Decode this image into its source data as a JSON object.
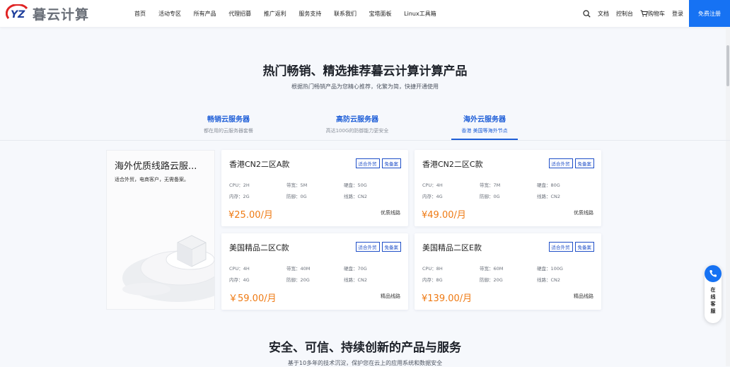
{
  "header": {
    "logo_text": "暮云计算",
    "logo_mark": "YZ",
    "nav": [
      "首页",
      "活动专区",
      "所有产品",
      "代理招募",
      "推广返利",
      "服务支持",
      "联系我们",
      "宝塔面板",
      "Linux工具箱"
    ],
    "docs_label": "文档",
    "console_label": "控制台",
    "cart_label": "购物车",
    "login_label": "登录",
    "register_label": "免费注册"
  },
  "hero": {
    "title": "热门畅销、精选推荐暮云计算计算产品",
    "subtitle": "根据热门畅销产品为您精心推荐，化繁为简，快捷开通使用"
  },
  "tabs": [
    {
      "title": "畅销云服务器",
      "desc": "都在用的云服务器套餐"
    },
    {
      "title": "高防云服务器",
      "desc": "高达100G的防御能力更安全"
    },
    {
      "title": "海外云服务器",
      "desc": "香港 美国等海外节点"
    }
  ],
  "active_tab": 2,
  "promo": {
    "title": "海外优质线路云服...",
    "subtitle": "适合外贸，电商客户，无需备案。"
  },
  "products": [
    {
      "name": "香港CN2二区A款",
      "badges": [
        "适合外贸",
        "免备案"
      ],
      "cpu": "CPU：2H",
      "bandwidth": "带宽：5M",
      "disk": "硬盘：50G",
      "ram": "内存：2G",
      "defense": "防御：0G",
      "line": "线路：CN2",
      "price": "¥25.00/月",
      "tag": "优质线路"
    },
    {
      "name": "香港CN2二区C款",
      "badges": [
        "适合外贸",
        "免备案"
      ],
      "cpu": "CPU：4H",
      "bandwidth": "带宽：7M",
      "disk": "硬盘：80G",
      "ram": "内存：4G",
      "defense": "防御：0G",
      "line": "线路：CN2",
      "price": "¥49.00/月",
      "tag": "优质线路"
    },
    {
      "name": "美国精品二区C款",
      "badges": [
        "适合外贸",
        "免备案"
      ],
      "cpu": "CPU：4H",
      "bandwidth": "带宽：40M",
      "disk": "硬盘：70G",
      "ram": "内存：4G",
      "defense": "防御：20G",
      "line": "线路：CN2",
      "price": "￥59.00/月",
      "tag": "精品线路"
    },
    {
      "name": "美国精品二区E款",
      "badges": [
        "适合外贸",
        "免备案"
      ],
      "cpu": "CPU：8H",
      "bandwidth": "带宽：60M",
      "disk": "硬盘：100G",
      "ram": "内存：8G",
      "defense": "防御：20G",
      "line": "线路：CN2",
      "price": "¥139.00/月",
      "tag": "精品线路"
    }
  ],
  "section2": {
    "title": "安全、可信、持续创新的产品与服务",
    "subtitle": "基于10多年的技术沉淀，保护您在云上的应用系统和数据安全"
  },
  "float_service": {
    "label_chars": [
      "在",
      "线",
      "客",
      "服"
    ]
  },
  "colors": {
    "brand_blue": "#1672f3",
    "price_orange": "#ef7a13",
    "tab_blue": "#1f5fd8",
    "logo_red": "#e02424"
  }
}
